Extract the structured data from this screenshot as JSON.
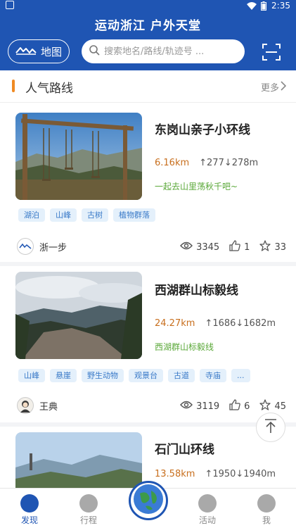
{
  "status_bar": {
    "time": "2:35"
  },
  "header": {
    "title": "运动浙江 户外天堂",
    "map_label": "地图",
    "search_placeholder": "搜索地名/路线/轨迹号 ..."
  },
  "section": {
    "title": "人气路线",
    "more": "更多"
  },
  "routes": [
    {
      "name": "东岗山亲子小环线",
      "distance": "6.16km",
      "elevation": "↑277↓278m",
      "desc": "一起去山里荡秋千吧~",
      "tags": [
        "湖泊",
        "山峰",
        "古树",
        "植物群落"
      ],
      "author": "浙一步",
      "views": "3345",
      "likes": "1",
      "favs": "33"
    },
    {
      "name": "西湖群山标毅线",
      "distance": "24.27km",
      "elevation": "↑1686↓1682m",
      "desc": "西湖群山标毅线",
      "tags": [
        "山峰",
        "悬崖",
        "野生动物",
        "观景台",
        "古道",
        "寺庙",
        "..."
      ],
      "author": "王典",
      "views": "3119",
      "likes": "6",
      "favs": "45"
    },
    {
      "name": "石门山环线",
      "distance": "13.58km",
      "elevation": "↑1950↓1940m",
      "desc": ""
    }
  ],
  "tabbar": {
    "discover": "发现",
    "trip": "行程",
    "activity": "活动",
    "me": "我"
  },
  "colors": {
    "brand": "#1f55b3",
    "accent": "#f08a24",
    "distance": "#c86f1e",
    "desc": "#5aa838"
  }
}
